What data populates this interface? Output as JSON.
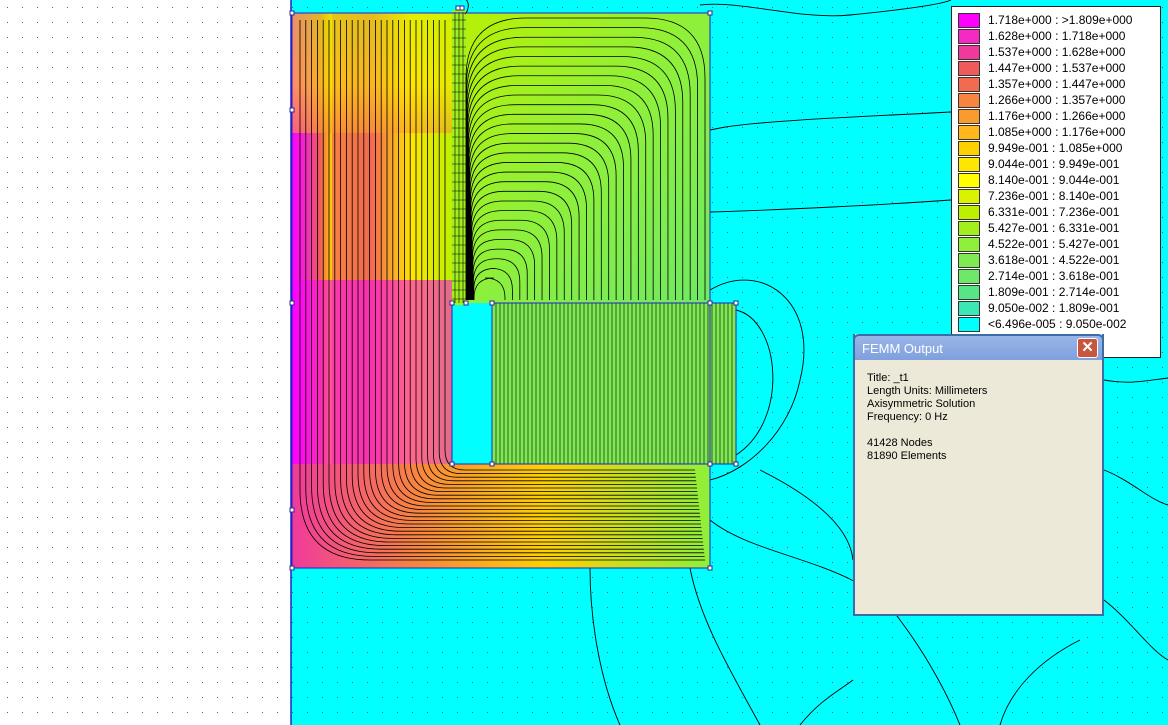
{
  "legend": {
    "rows": [
      {
        "color": "#ff00ff",
        "label": "1.718e+000 : >1.809e+000"
      },
      {
        "color": "#f52ac4",
        "label": "1.628e+000 : 1.718e+000"
      },
      {
        "color": "#f03a9b",
        "label": "1.537e+000 : 1.628e+000"
      },
      {
        "color": "#ef5a5a",
        "label": "1.447e+000 : 1.537e+000"
      },
      {
        "color": "#f26a50",
        "label": "1.357e+000 : 1.447e+000"
      },
      {
        "color": "#f7853f",
        "label": "1.266e+000 : 1.357e+000"
      },
      {
        "color": "#fb9b2e",
        "label": "1.176e+000 : 1.266e+000"
      },
      {
        "color": "#ffb81b",
        "label": "1.085e+000 : 1.176e+000"
      },
      {
        "color": "#ffd000",
        "label": "9.949e-001 : 1.085e+000"
      },
      {
        "color": "#ffe600",
        "label": "9.044e-001 : 9.949e-001"
      },
      {
        "color": "#ffff00",
        "label": "8.140e-001 : 9.044e-001"
      },
      {
        "color": "#d8f200",
        "label": "7.236e-001 : 8.140e-001"
      },
      {
        "color": "#bcf000",
        "label": "6.331e-001 : 7.236e-001"
      },
      {
        "color": "#a3ef1e",
        "label": "5.427e-001 : 6.331e-001"
      },
      {
        "color": "#8ef03a",
        "label": "4.522e-001 : 5.427e-001"
      },
      {
        "color": "#7eeb52",
        "label": "3.618e-001 : 4.522e-001"
      },
      {
        "color": "#6ee868",
        "label": "2.714e-001 : 3.618e-001"
      },
      {
        "color": "#57e686",
        "label": "1.809e-001 : 2.714e-001"
      },
      {
        "color": "#3be8b3",
        "label": "9.050e-002 : 1.809e-001"
      },
      {
        "color": "#00ffff",
        "label": "<6.496e-005 : 9.050e-002"
      }
    ]
  },
  "dialog": {
    "title": "FEMM Output",
    "close_glyph": "✕",
    "title_line": "Title: _t1",
    "units_line": "Length Units: Millimeters",
    "solution_line": "Axisymmetric Solution",
    "frequency_line": "Frequency: 0 Hz",
    "nodes_line": "41428 Nodes",
    "elements_line": "81890 Elements"
  },
  "colors": {
    "background_field": "#00ffff",
    "grid_dot": "#4a5a9a",
    "axis": "#2222cc",
    "contour": "#000000",
    "node": "#2b2b8a"
  }
}
